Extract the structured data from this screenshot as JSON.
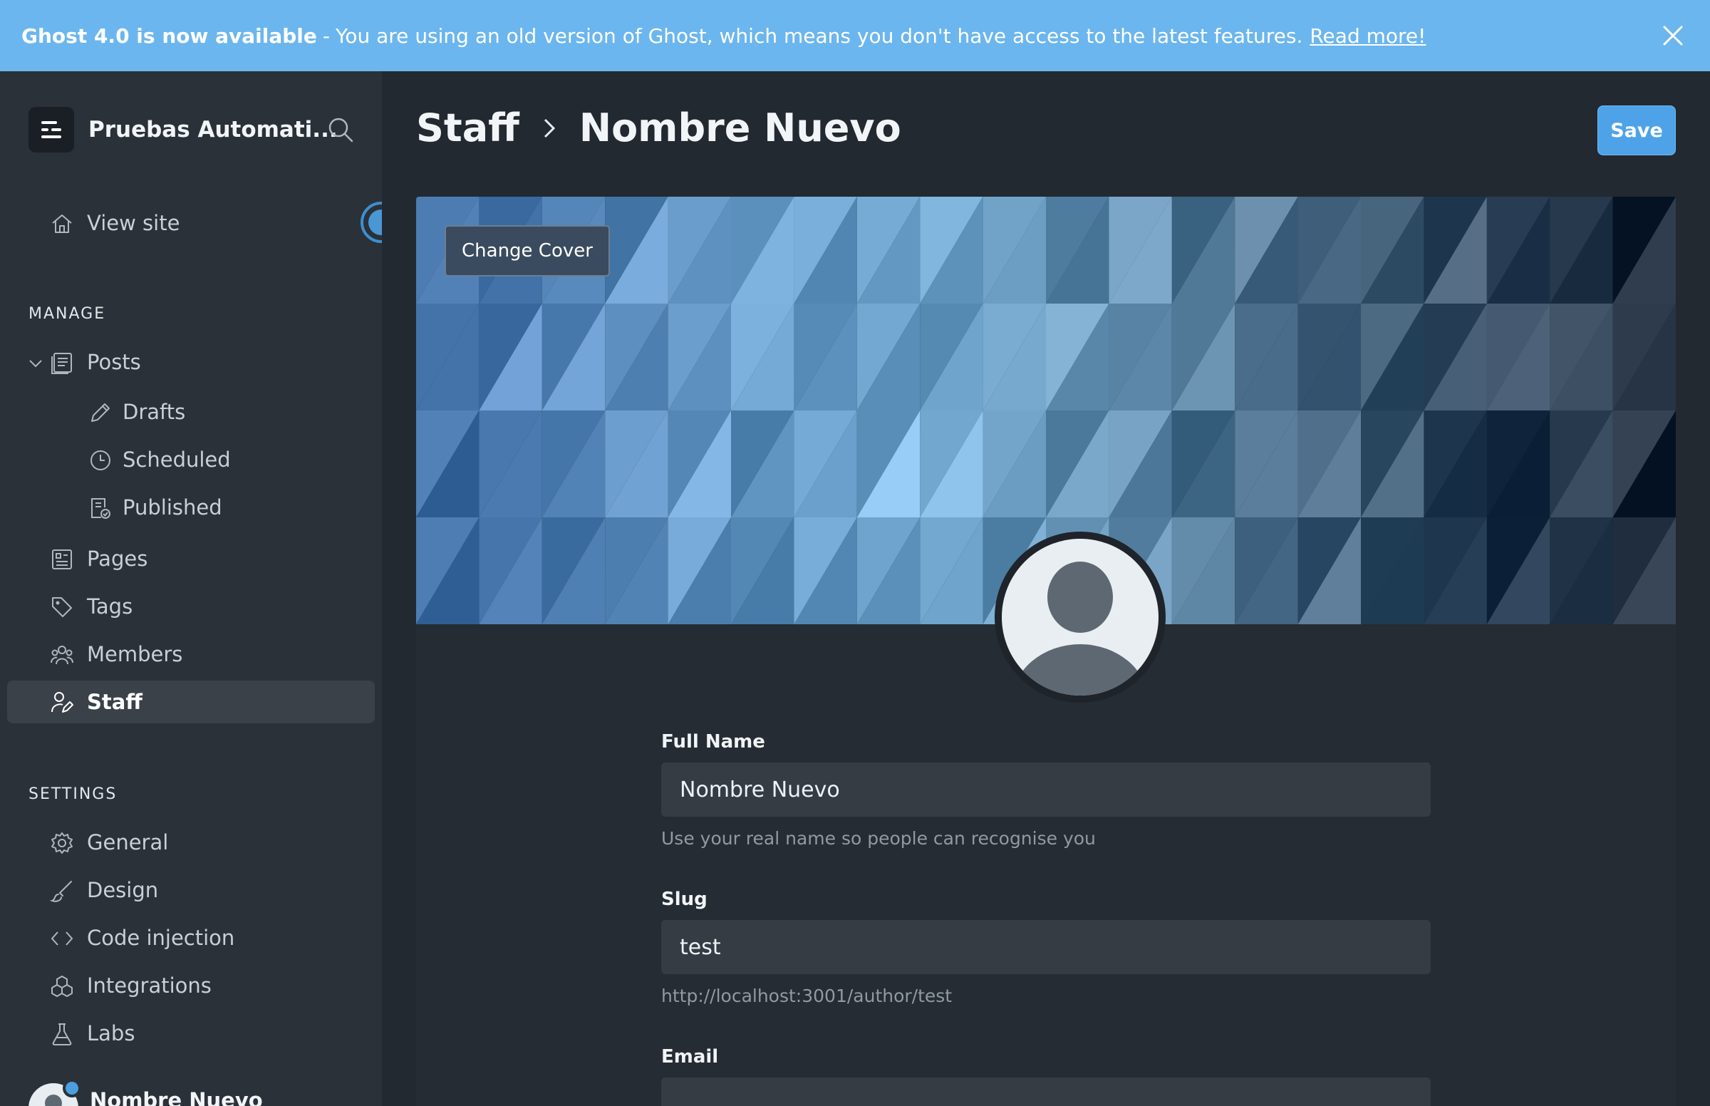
{
  "banner": {
    "title": "Ghost 4.0 is now available",
    "separator": "-",
    "message": "You are using an old version of Ghost, which means you don't have access to the latest features.",
    "link": "Read more!"
  },
  "sidebar": {
    "brand": "Pruebas Automati...",
    "view_site": "View site",
    "manage_label": "MANAGE",
    "manage_items": {
      "posts": "Posts",
      "drafts": "Drafts",
      "scheduled": "Scheduled",
      "published": "Published",
      "pages": "Pages",
      "tags": "Tags",
      "members": "Members",
      "staff": "Staff"
    },
    "settings_label": "SETTINGS",
    "settings_items": {
      "general": "General",
      "design": "Design",
      "code_injection": "Code injection",
      "integrations": "Integrations",
      "labs": "Labs"
    },
    "user_name": "Nombre Nuevo"
  },
  "header": {
    "crumb_parent": "Staff",
    "crumb_current": "Nombre Nuevo",
    "save_label": "Save"
  },
  "cover": {
    "change_label": "Change Cover"
  },
  "form": {
    "full_name_label": "Full Name",
    "full_name_value": "Nombre Nuevo",
    "full_name_help": "Use your real name so people can recognise you",
    "slug_label": "Slug",
    "slug_value": "test",
    "slug_help": "http://localhost:3001/author/test",
    "email_label": "Email"
  },
  "colors": {
    "banner": "#6bb6ee",
    "sidebar": "#2a3138",
    "main": "#222930",
    "accent": "#4ea3e8"
  }
}
